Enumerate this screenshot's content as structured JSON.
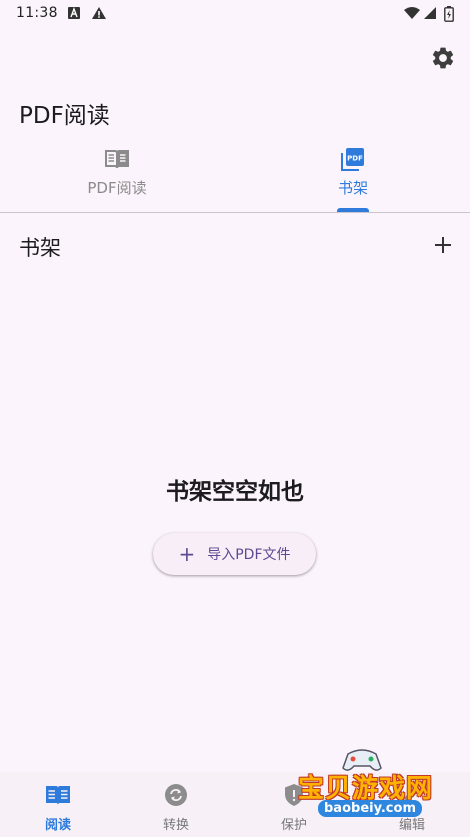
{
  "status_bar": {
    "time": "11:38"
  },
  "header": {
    "title": "PDF阅读"
  },
  "tabs": [
    {
      "label": "PDF阅读",
      "icon": "book-open-icon",
      "active": false
    },
    {
      "label": "书架",
      "icon": "pdf-file-icon",
      "active": true
    }
  ],
  "section": {
    "title": "书架"
  },
  "empty_state": {
    "title": "书架空空如也",
    "button_label": "导入PDF文件"
  },
  "bottom_nav": [
    {
      "label": "阅读",
      "icon": "book-icon",
      "active": true
    },
    {
      "label": "转换",
      "icon": "convert-icon",
      "active": false
    },
    {
      "label": "保护",
      "icon": "shield-icon",
      "active": false
    },
    {
      "label": "编辑",
      "icon": "edit-icon",
      "active": false
    }
  ],
  "watermark": {
    "text": "宝贝游戏网",
    "url": "baobeiy.com"
  },
  "colors": {
    "accent": "#2e7bdc",
    "background": "#fcf4fc",
    "button_text": "#5d4a93"
  }
}
